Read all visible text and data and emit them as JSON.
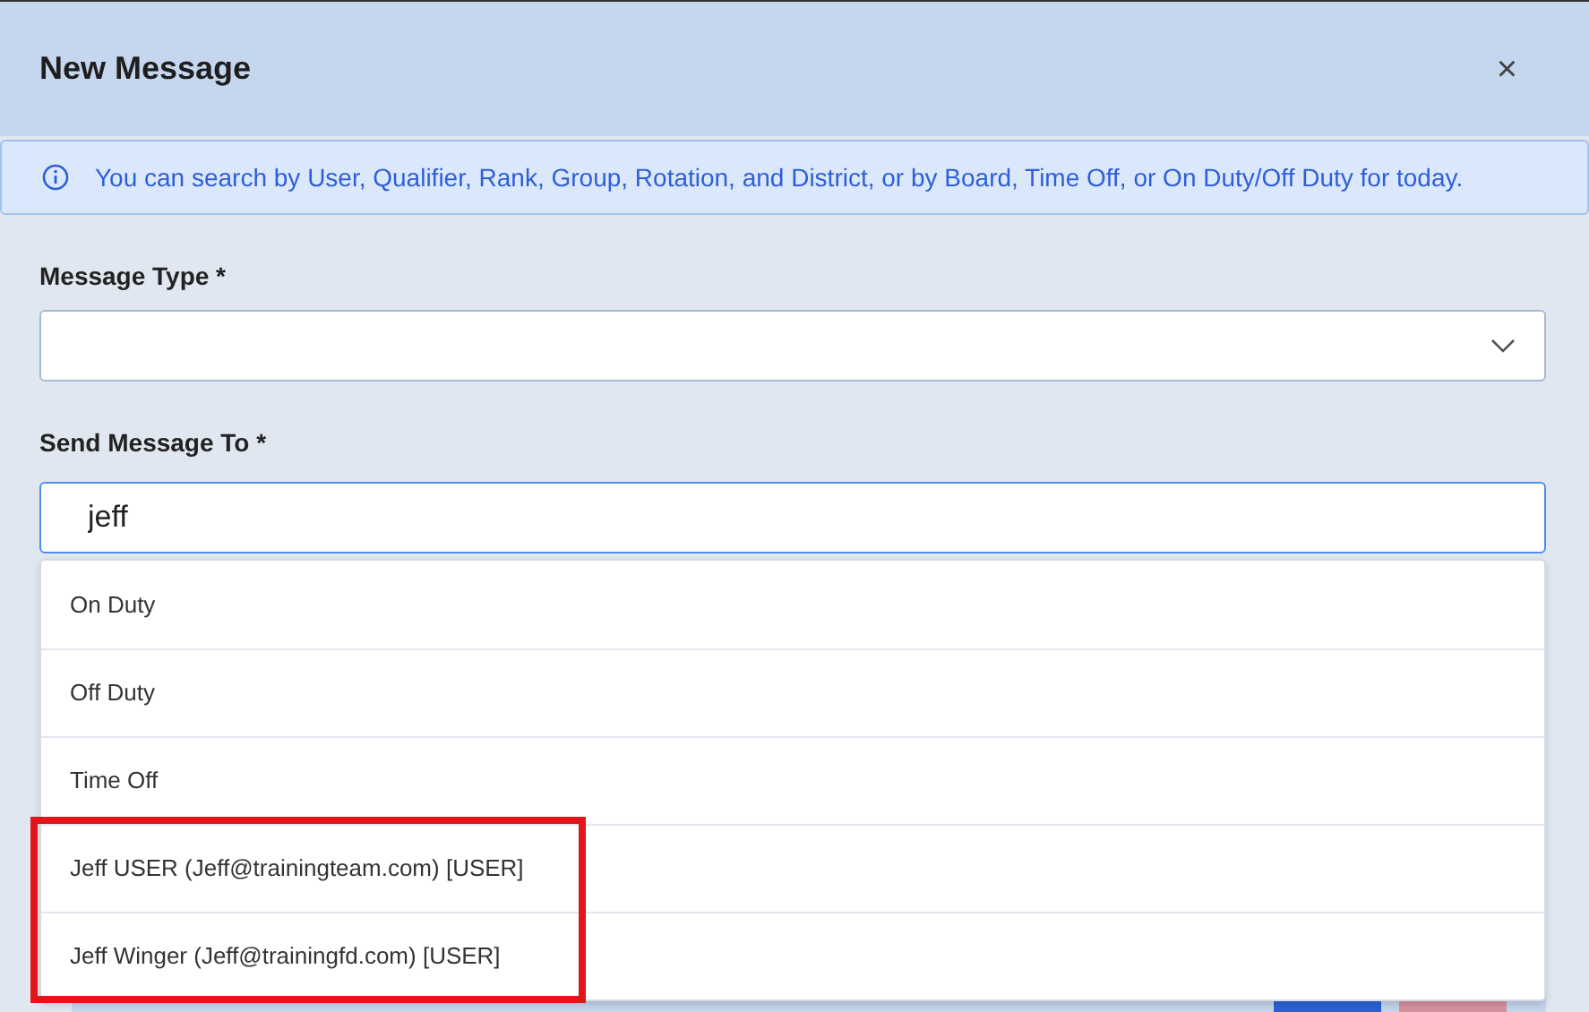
{
  "window": {
    "title": "New Message",
    "close": "×"
  },
  "info": {
    "text": "You can search by User, Qualifier, Rank, Group, Rotation, and District, or by Board, Time Off, or On Duty/Off Duty for today."
  },
  "message_type": {
    "label": "Message Type  *"
  },
  "send_to": {
    "label": "Send Message To *",
    "value": "jeff"
  },
  "suggestions": [
    {
      "label": "On Duty",
      "highlighted": false
    },
    {
      "label": "Off Duty",
      "highlighted": false
    },
    {
      "label": "Time Off",
      "highlighted": false
    },
    {
      "label": "Jeff USER (Jeff@trainingteam.com) [USER]",
      "highlighted": true
    },
    {
      "label": "Jeff Winger (Jeff@trainingfd.com) [USER]",
      "highlighted": true
    }
  ]
}
